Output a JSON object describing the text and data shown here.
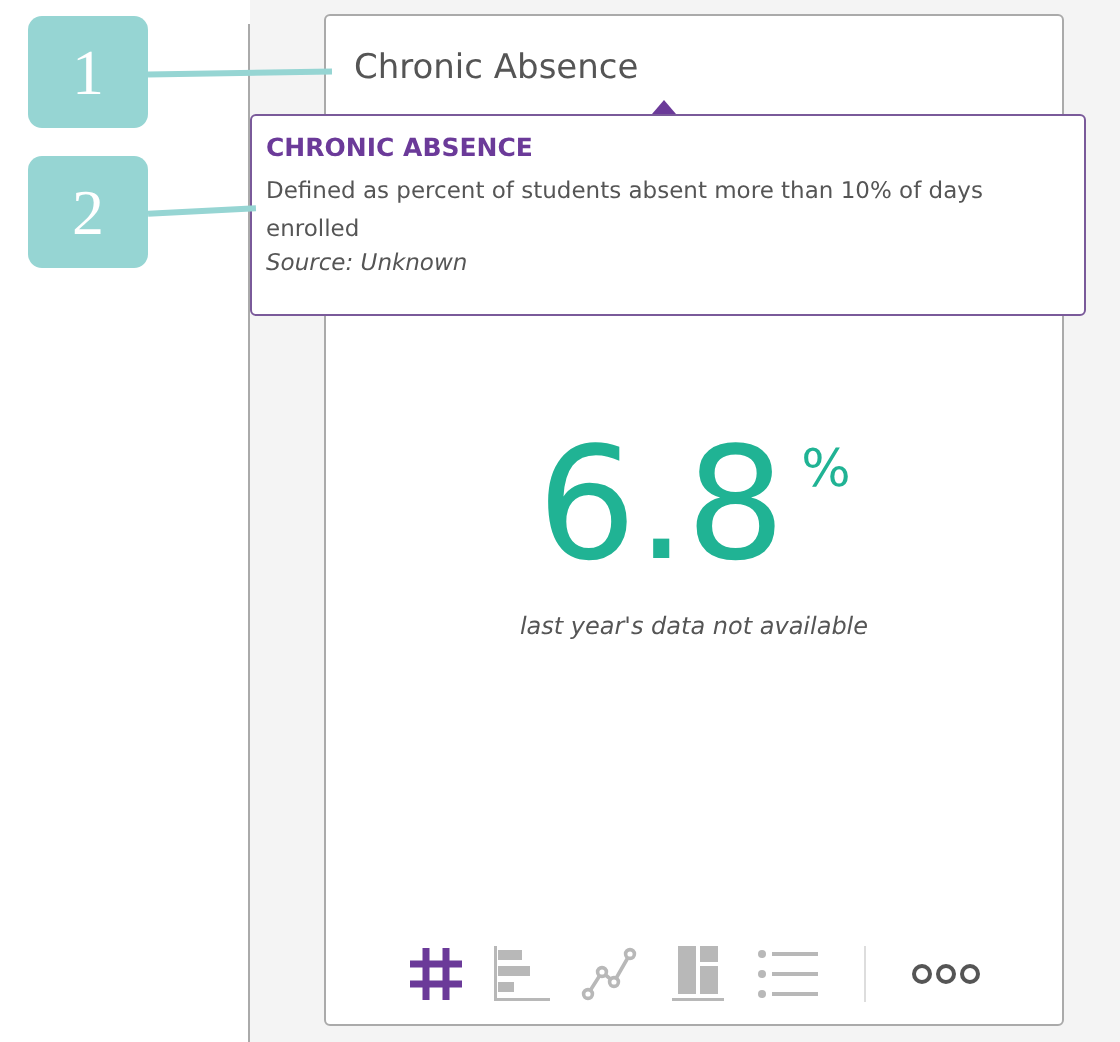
{
  "callouts": [
    {
      "label": "1"
    },
    {
      "label": "2"
    }
  ],
  "card": {
    "title": "Chronic Absence",
    "value": "6.8",
    "unit": "%",
    "note": "last year's data not available",
    "views": [
      {
        "kind": "number",
        "selected": true
      },
      {
        "kind": "bars",
        "selected": false
      },
      {
        "kind": "line",
        "selected": false
      },
      {
        "kind": "blocks",
        "selected": false
      },
      {
        "kind": "list",
        "selected": false
      }
    ]
  },
  "tooltip": {
    "title": "CHRONIC ABSENCE",
    "description": "Defined as percent of students absent more than 10% of days enrolled",
    "source": "Source: Unknown"
  }
}
